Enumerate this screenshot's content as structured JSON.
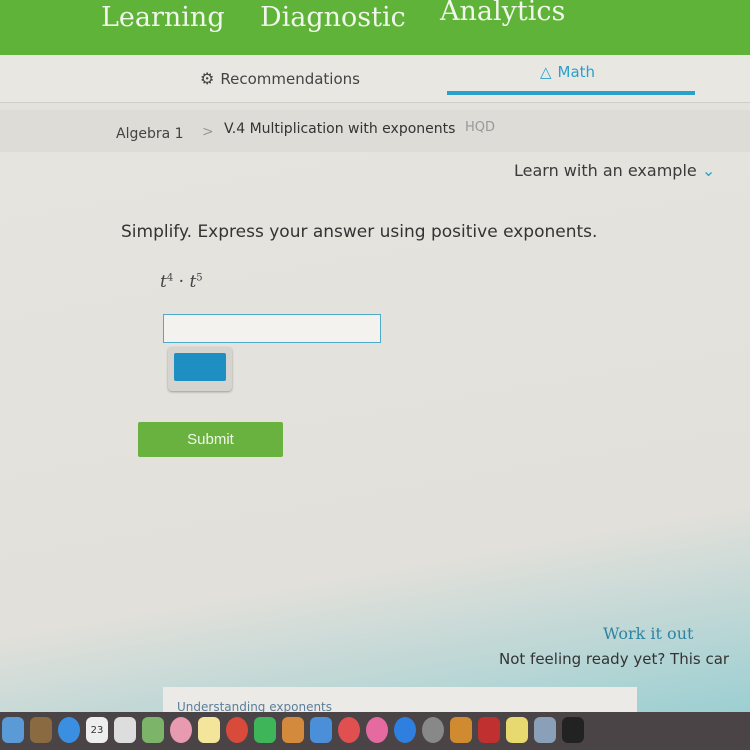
{
  "topnav": {
    "items": [
      "Learning",
      "Diagnostic",
      "Analytics"
    ]
  },
  "tabs": {
    "recommendations": "Recommendations",
    "math": "Math"
  },
  "breadcrumb": {
    "course": "Algebra 1",
    "separator": ">",
    "skill": "V.4 Multiplication with exponents",
    "code": "HQD"
  },
  "main": {
    "learn_example": "Learn with an example",
    "question": "Simplify. Express your answer using positive exponents.",
    "expr": {
      "base1": "t",
      "exp1": "4",
      "dot": "·",
      "base2": "t",
      "exp2": "5"
    },
    "answer_value": "",
    "submit": "Submit",
    "work_it_out": "Work it out",
    "not_ready": "Not feeling ready yet? This car",
    "card_title": "Understanding exponents"
  },
  "dock": {
    "icons": [
      "finder",
      "contacts",
      "messages",
      "calendar",
      "reminders",
      "maps",
      "photos",
      "notes",
      "chrome",
      "facetime",
      "pages",
      "keynote",
      "news",
      "music",
      "app-store",
      "system-preferences",
      "ibooks",
      "photo-booth",
      "stickies",
      "preview",
      "terminal"
    ],
    "calendar_date": "23"
  },
  "colors": {
    "green": "#5fb338",
    "accent": "#2aa0cc"
  }
}
